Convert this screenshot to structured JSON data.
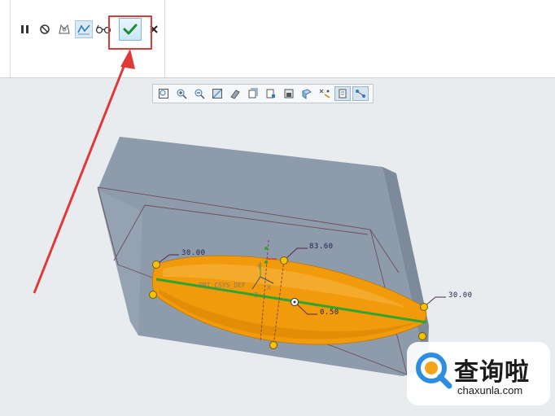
{
  "ribbon": {
    "tools": [
      {
        "name": "pause",
        "icon": "pause-icon"
      },
      {
        "name": "stop",
        "icon": "no-entry-icon"
      },
      {
        "name": "feature-preview",
        "icon": "feature-preview-icon"
      },
      {
        "name": "verify",
        "icon": "verify-icon"
      },
      {
        "name": "glasses-preview",
        "icon": "glasses-icon"
      },
      {
        "name": "ok",
        "icon": "check-icon"
      },
      {
        "name": "cancel",
        "icon": "close-icon"
      }
    ]
  },
  "view_toolbar": {
    "tools": [
      "refit-icon",
      "zoom-in-icon",
      "zoom-out-icon",
      "repaint-icon",
      "display-style-icon",
      "saved-orientations-icon",
      "saved-views-icon",
      "view-manager-icon",
      "perspective-icon",
      "datum-display-icon",
      "spin-center-icon",
      "annotation-display-icon"
    ]
  },
  "dimensions": {
    "top_left": "30.00",
    "top_center": "83.60",
    "right": "30.00",
    "center": "0.50"
  },
  "csys": {
    "label": "PRT_CSYS_DEF",
    "x_label": "X",
    "y_label": "Y",
    "z_label": "Z"
  },
  "watermark": {
    "title": "查询啦",
    "url": "chaxunla.com"
  },
  "colors": {
    "box_fill": "#8e9bab",
    "box_top": "#a4afbd",
    "blend_fill": "#f09a0c",
    "centerline": "#2fa52f",
    "annotation_arrow": "#e0393a",
    "handle": "#f2c200"
  }
}
